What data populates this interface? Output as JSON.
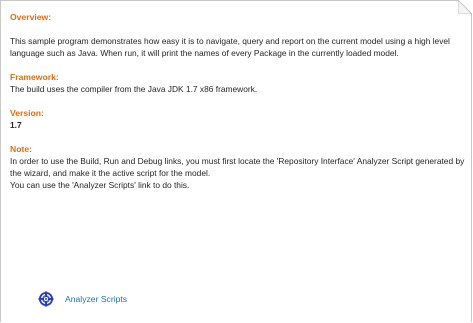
{
  "overview": {
    "heading": "Overview:",
    "text": "This sample program demonstrates how easy it is to navigate, query and report on the current model using a high level language such as Java.  When run, it will print the names of every Package in the currently loaded model."
  },
  "framework": {
    "heading": "Framework:",
    "text": "The build uses the compiler from the Java JDK 1.7 x86 framework."
  },
  "version": {
    "heading": "Version:",
    "value": "1.7"
  },
  "note": {
    "heading": "Note:",
    "line1": "In order to use the Build, Run and Debug links, you must first locate the 'Repository Interface' Analyzer Script generated by the wizard, and make it the active script for the model.",
    "line2": "You can use the 'Analyzer Scripts' link to do this."
  },
  "link": {
    "label": "Analyzer Scripts",
    "icon": "analyzer-scripts-icon"
  },
  "colors": {
    "heading": "#e46c0a",
    "link": "#1f6fbf",
    "text": "#262626"
  }
}
